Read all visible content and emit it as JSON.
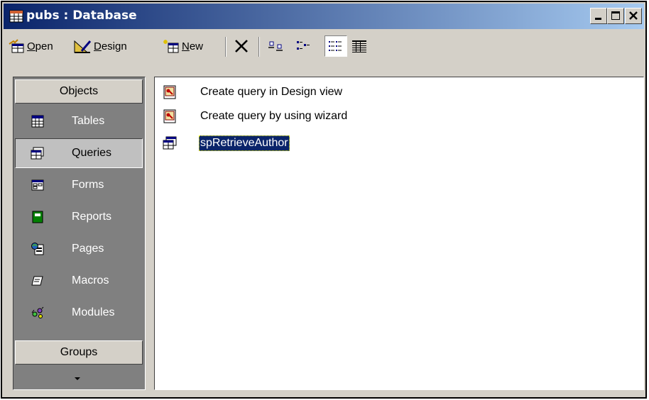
{
  "window": {
    "title": "pubs : Database",
    "title_icon": "database-window-icon",
    "buttons": [
      "minimize-icon",
      "maximize-icon",
      "close-icon"
    ]
  },
  "toolbar": {
    "open": {
      "pre": "",
      "underlined": "O",
      "post": "pen",
      "icon": "open-query-icon"
    },
    "design": {
      "pre": "",
      "underlined": "D",
      "post": "esign",
      "icon": "design-icon"
    },
    "new": {
      "pre": "",
      "underlined": "N",
      "post": "ew",
      "icon": "new-object-icon"
    },
    "delete_icon": "delete-x-icon",
    "view_icons": [
      "large-icons-icon",
      "small-icons-icon",
      "list-view-icon",
      "details-view-icon"
    ]
  },
  "sidebar": {
    "objects_header": "Objects",
    "groups_header": "Groups",
    "items": [
      {
        "label": "Tables",
        "icon": "table-icon"
      },
      {
        "label": "Queries",
        "icon": "query-icon",
        "selected": true
      },
      {
        "label": "Forms",
        "icon": "form-icon"
      },
      {
        "label": "Reports",
        "icon": "report-icon"
      },
      {
        "label": "Pages",
        "icon": "page-icon"
      },
      {
        "label": "Macros",
        "icon": "macro-icon"
      },
      {
        "label": "Modules",
        "icon": "module-icon"
      }
    ]
  },
  "list": {
    "items": [
      {
        "label": "Create query in Design view",
        "icon": "wizard-key-icon"
      },
      {
        "label": "Create query by using wizard",
        "icon": "wizard-key-icon"
      },
      {
        "label": "spRetrieveAuthor",
        "icon": "stored-procedure-icon",
        "selected": true
      }
    ]
  },
  "colors": {
    "titlebar_start": "#0a246a",
    "titlebar_end": "#a6caf0",
    "sidebar_bg": "#808080",
    "selection": "#0a246a",
    "face": "#d4d0c8"
  }
}
